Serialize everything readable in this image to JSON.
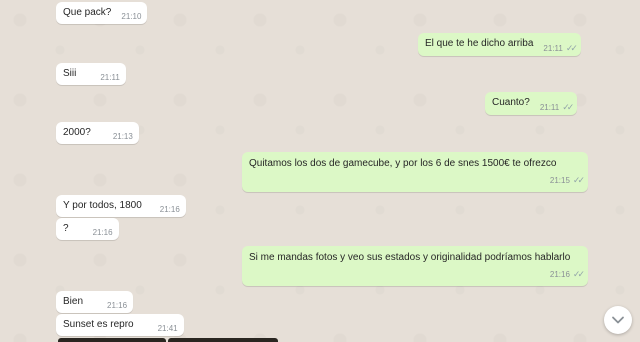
{
  "messages": [
    {
      "dir": "in",
      "text": "Que pack?",
      "time": "21:10"
    },
    {
      "dir": "out",
      "text": "El que te he dicho arriba",
      "time": "21:11"
    },
    {
      "dir": "in",
      "text": "Siii",
      "time": "21:11"
    },
    {
      "dir": "out",
      "text": "Cuanto?",
      "time": "21:11"
    },
    {
      "dir": "in",
      "text": "2000?",
      "time": "21:13"
    },
    {
      "dir": "out",
      "text": "Quitamos los dos de gamecube, y por los 6 de snes 1500€ te ofrezco",
      "time": "21:15"
    },
    {
      "dir": "in",
      "text": "Y por todos, 1800",
      "time": "21:16"
    },
    {
      "dir": "in",
      "text": "?",
      "time": "21:16"
    },
    {
      "dir": "out",
      "text": "Si me mandas fotos y veo sus estados y originalidad podríamos hablarlo",
      "time": "21:16"
    },
    {
      "dir": "in",
      "text": "Bien",
      "time": "21:16"
    },
    {
      "dir": "in",
      "text": "Sunset es repro",
      "time": "21:41"
    }
  ],
  "icons": {
    "read_ticks": "double-check-icon",
    "scroll_down": "chevron-down-icon"
  },
  "colors": {
    "incoming_bubble": "#ffffff",
    "outgoing_bubble": "#dcf8c6",
    "background": "#e6dfd7",
    "timestamp": "#8a9096"
  }
}
